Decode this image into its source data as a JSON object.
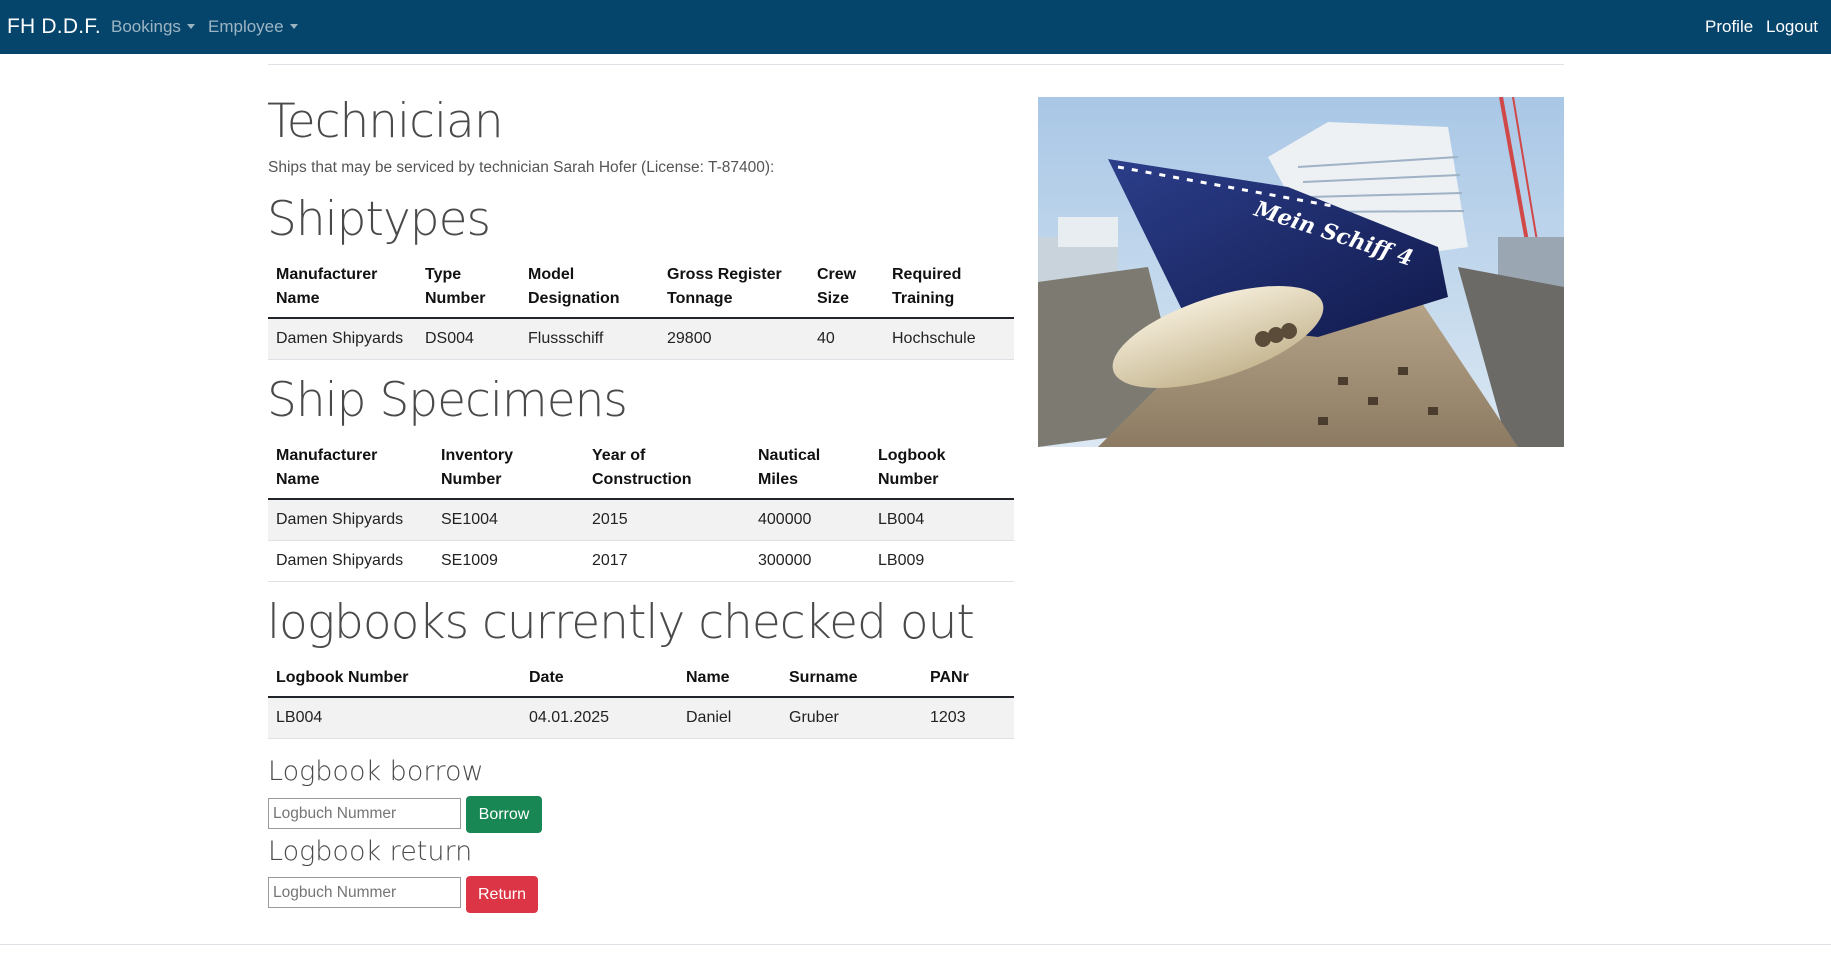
{
  "navbar": {
    "brand": "FH D.D.F.",
    "menus": [
      "Bookings",
      "Employee"
    ],
    "right_links": [
      "Profile",
      "Logout"
    ],
    "background": "#05446b"
  },
  "page": {
    "title": "Technician",
    "subtitle": "Ships that may be serviced by technician Sarah Hofer (License: T-87400):"
  },
  "shiptypes": {
    "heading": "Shiptypes",
    "headers": [
      [
        "Manufacturer",
        "Name"
      ],
      [
        "Type",
        "Number"
      ],
      [
        "Model",
        "Designation"
      ],
      [
        "Gross Register",
        "Tonnage"
      ],
      [
        "Crew",
        "Size"
      ],
      [
        "Required",
        "Training"
      ]
    ],
    "rows": [
      [
        "Damen Shipyards",
        "DS004",
        "Flussschiff",
        "29800",
        "40",
        "Hochschule"
      ]
    ]
  },
  "specimens": {
    "heading": "Ship Specimens",
    "headers": [
      [
        "Manufacturer",
        "Name"
      ],
      [
        "Inventory",
        "Number"
      ],
      [
        "Year of",
        "Construction"
      ],
      [
        "Nautical",
        "Miles"
      ],
      [
        "Logbook",
        "Number"
      ]
    ],
    "rows": [
      [
        "Damen Shipyards",
        "SE1004",
        "2015",
        "400000",
        "LB004"
      ],
      [
        "Damen Shipyards",
        "SE1009",
        "2017",
        "300000",
        "LB009"
      ]
    ]
  },
  "logbooks": {
    "heading": "logbooks currently checked out",
    "headers": [
      "Logbook Number",
      "Date",
      "Name",
      "Surname",
      "PANr"
    ],
    "rows": [
      [
        "LB004",
        "04.01.2025",
        "Daniel",
        "Gruber",
        "1203"
      ]
    ]
  },
  "borrow": {
    "heading": "Logbook borrow",
    "placeholder": "Logbuch Nummer",
    "button": "Borrow",
    "color": "#198754"
  },
  "return": {
    "heading": "Logbook return",
    "placeholder": "Logbuch Nummer",
    "button": "Return",
    "color": "#dc3545"
  },
  "image": {
    "ship_lettering": "Mein Schiff 4"
  }
}
